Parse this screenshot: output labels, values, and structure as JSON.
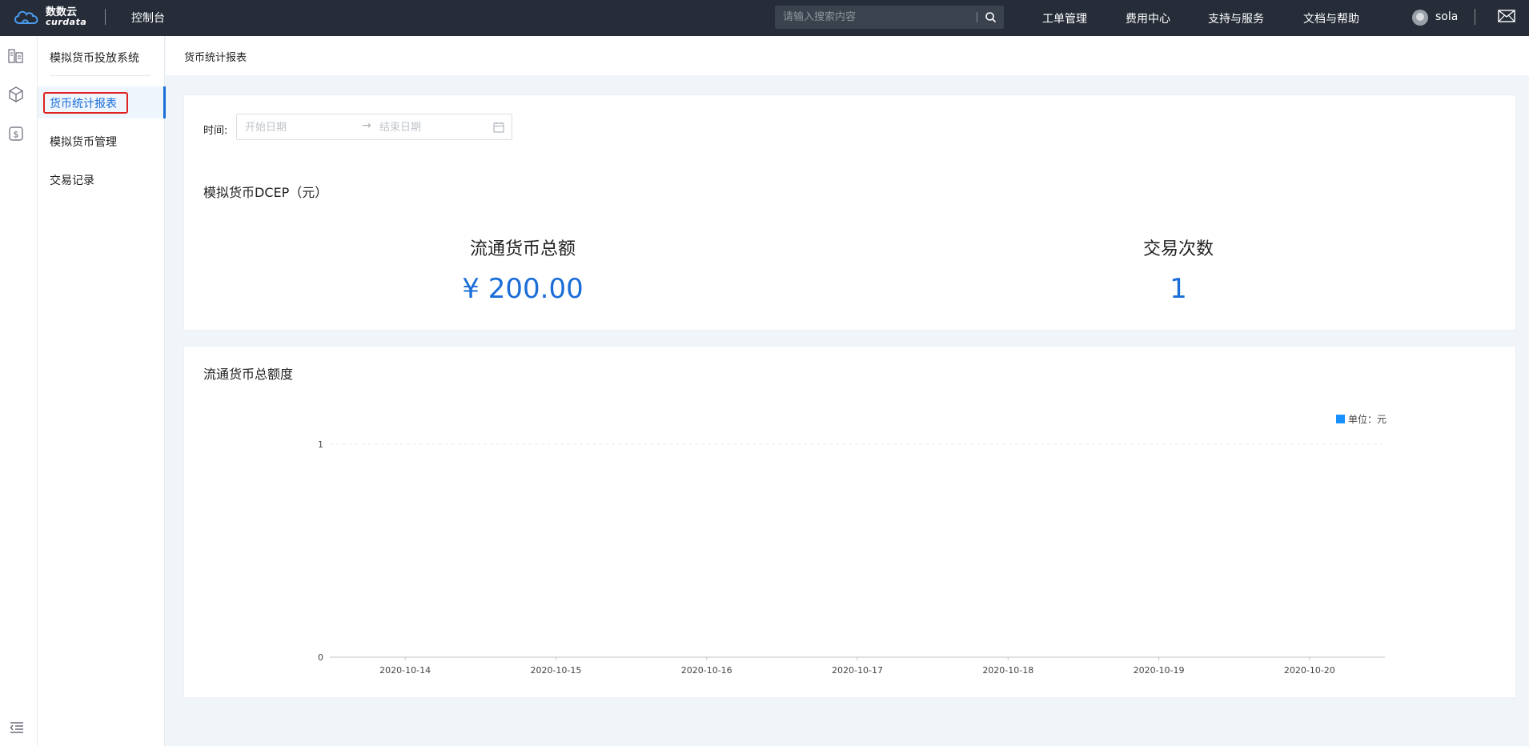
{
  "header": {
    "logo_cn": "数数云",
    "logo_en": "curdata",
    "console": "控制台",
    "search_placeholder": "请输入搜索内容",
    "nav": [
      "工单管理",
      "费用中心",
      "支持与服务",
      "文档与帮助"
    ],
    "username": "sola"
  },
  "sidebar": {
    "title": "模拟货币投放系统",
    "items": [
      {
        "label": "货币统计报表",
        "active": true
      },
      {
        "label": "模拟货币管理",
        "active": false
      },
      {
        "label": "交易记录",
        "active": false
      }
    ]
  },
  "page": {
    "breadcrumb": "货币统计报表"
  },
  "filters": {
    "time_label": "时间:",
    "start_placeholder": "开始日期",
    "end_placeholder": "结束日期"
  },
  "summary": {
    "title": "模拟货币DCEP（元）",
    "stats": [
      {
        "label": "流通货币总额",
        "value": "¥ 200.00"
      },
      {
        "label": "交易次数",
        "value": "1"
      }
    ]
  },
  "chart_data": {
    "type": "line",
    "title": "流通货币总额度",
    "x": [
      "2020-10-14",
      "2020-10-15",
      "2020-10-16",
      "2020-10-17",
      "2020-10-18",
      "2020-10-19",
      "2020-10-20"
    ],
    "series": [
      {
        "name": "单位：元",
        "values": [
          null,
          null,
          null,
          null,
          null,
          null,
          null
        ]
      }
    ],
    "ylim": [
      0,
      1
    ],
    "yticks": [
      "0",
      "1"
    ],
    "legend": "top-right",
    "grid": true,
    "legend_color": "#1890ff"
  },
  "colors": {
    "accent": "#1a6dd8",
    "topbar": "#262d38",
    "highlight": "#e02020"
  }
}
